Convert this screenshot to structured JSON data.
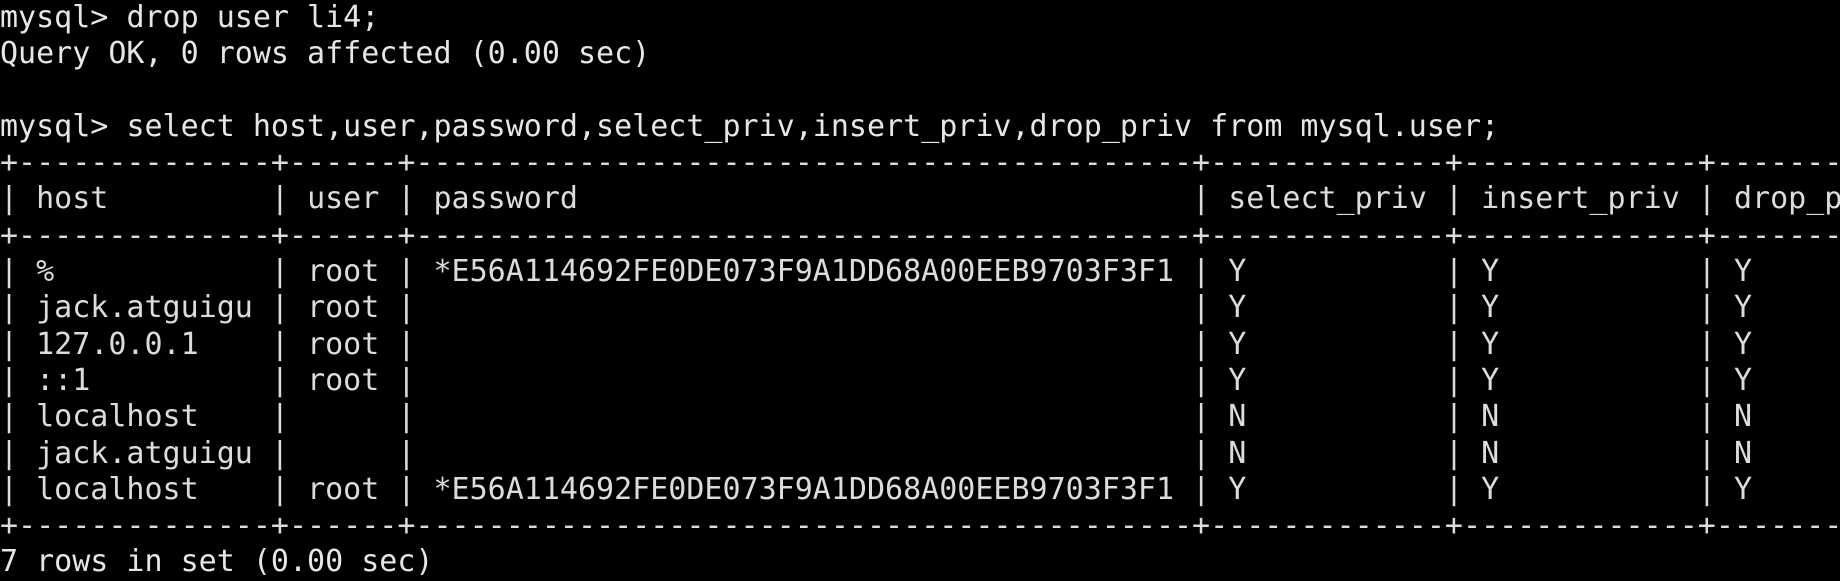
{
  "theme": {
    "background": "#000000",
    "foreground": "#e6e6e6"
  },
  "session": {
    "prompt": "mysql> ",
    "command1": "drop user li4;",
    "result1": "Query OK, 0 rows affected (0.00 sec)",
    "command2": "select host,user,password,select_priv,insert_priv,drop_priv from mysql.user;",
    "footer": "7 rows in set (0.00 sec)"
  },
  "table": {
    "columns": [
      "host",
      "user",
      "password",
      "select_priv",
      "insert_priv",
      "drop_priv"
    ],
    "rows": [
      [
        "%",
        "root",
        "*E56A114692FE0DE073F9A1DD68A00EEB9703F3F1",
        "Y",
        "Y",
        "Y"
      ],
      [
        "jack.atguigu",
        "root",
        "",
        "Y",
        "Y",
        "Y"
      ],
      [
        "127.0.0.1",
        "root",
        "",
        "Y",
        "Y",
        "Y"
      ],
      [
        "::1",
        "root",
        "",
        "Y",
        "Y",
        "Y"
      ],
      [
        "localhost",
        "",
        "",
        "N",
        "N",
        "N"
      ],
      [
        "jack.atguigu",
        "",
        "",
        "N",
        "N",
        "N"
      ],
      [
        "localhost",
        "root",
        "*E56A114692FE0DE073F9A1DD68A00EEB9703F3F1",
        "Y",
        "Y",
        "Y"
      ]
    ]
  }
}
